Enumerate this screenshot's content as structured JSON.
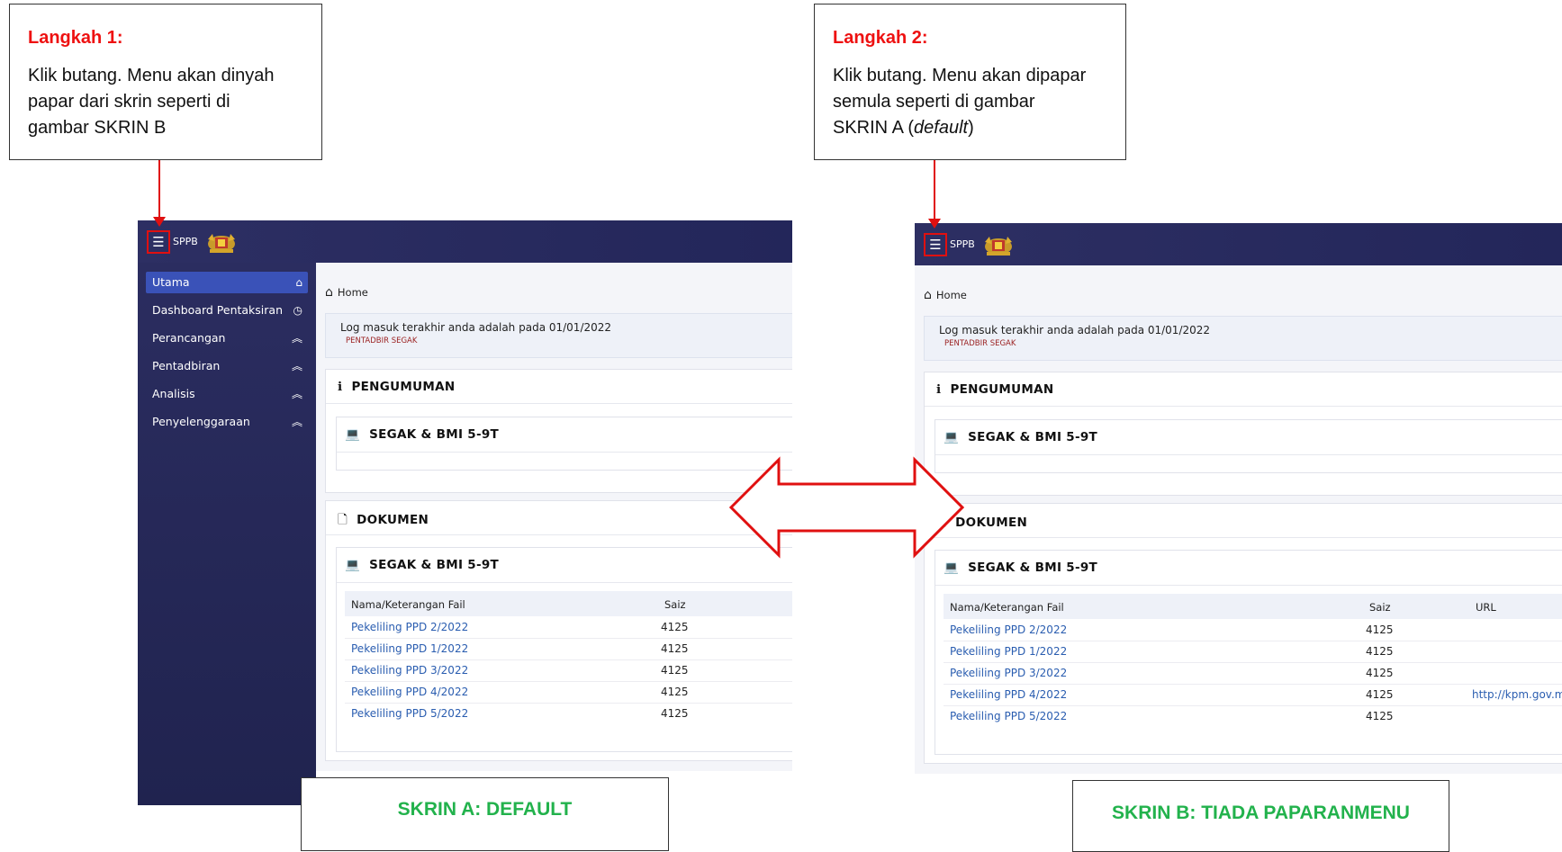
{
  "step1": {
    "title": "Langkah 1:",
    "lines": [
      "Klik butang. Menu akan dinyah",
      "papar dari skrin seperti di",
      "gambar SKRIN B"
    ]
  },
  "step2": {
    "title": "Langkah 2:",
    "line1": "Klik butang. Menu akan dipapar",
    "line2": "semula seperti di gambar",
    "line3_prefix": "SKRIN A (",
    "line3_italic": "default",
    "line3_suffix": ")"
  },
  "labels": {
    "screen_a": "SKRIN A: DEFAULT",
    "screen_b": "SKRIN B: TIADA PAPARANMENU"
  },
  "app": {
    "brand": "SPPB"
  },
  "sidebar": {
    "items": [
      {
        "label": "Utama",
        "icon": "home-icon",
        "glyph": "⌂"
      },
      {
        "label": "Dashboard Pentaksiran",
        "icon": "dashboard-icon",
        "glyph": "◷"
      },
      {
        "label": "Perancangan",
        "icon": "chevron-up-icon",
        "glyph": "︽"
      },
      {
        "label": "Pentadbiran",
        "icon": "chevron-up-icon",
        "glyph": "︽"
      },
      {
        "label": "Analisis",
        "icon": "chevron-up-icon",
        "glyph": "︽"
      },
      {
        "label": "Penyelenggaraan",
        "icon": "chevron-up-icon",
        "glyph": "︽"
      }
    ]
  },
  "breadcrumb": "Home",
  "login": {
    "text": "Log masuk terakhir anda adalah pada 01/01/2022",
    "role": "PENTADBIR SEGAK"
  },
  "pengumuman": {
    "title": "PENGUMUMAN",
    "sub_title": "SEGAK & BMI 5-9T"
  },
  "dokumen": {
    "title": "DOKUMEN",
    "sub_title": "SEGAK & BMI 5-9T"
  },
  "table": {
    "headers": {
      "name": "Nama/Keterangan Fail",
      "size": "Saiz",
      "url": "URL"
    },
    "rows": [
      {
        "name": "Pekeliling PPD 2/2022",
        "size": "4125",
        "url": ""
      },
      {
        "name": "Pekeliling PPD 1/2022",
        "size": "4125",
        "url": ""
      },
      {
        "name": "Pekeliling PPD 3/2022",
        "size": "4125",
        "url": ""
      },
      {
        "name": "Pekeliling PPD 4/2022",
        "size": "4125",
        "url": "http://kpm.gov.m"
      },
      {
        "name": "Pekeliling PPD 5/2022",
        "size": "4125",
        "url": ""
      }
    ]
  },
  "colors": {
    "accent_red": "#e11111",
    "label_green": "#22b24c",
    "topbar": "#2d2f63",
    "active_item": "#3a52b8",
    "link": "#2a5db0"
  }
}
